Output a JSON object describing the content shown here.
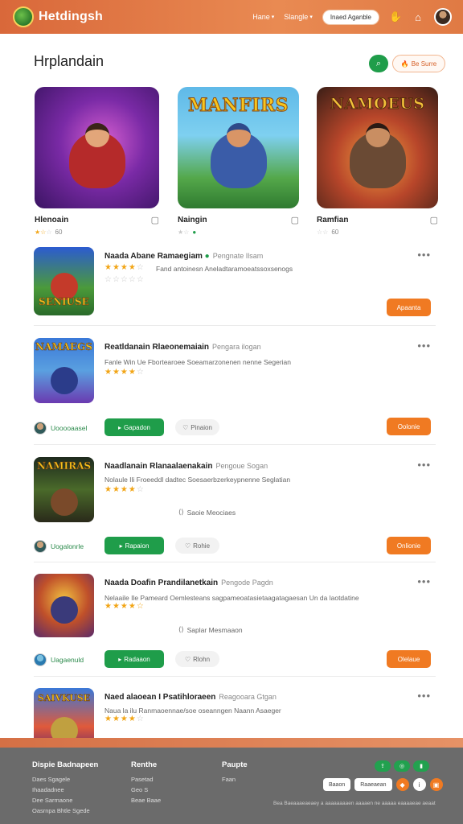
{
  "header": {
    "brand": "Hetdingsh",
    "nav": [
      {
        "label": "Hane"
      },
      {
        "label": "Slangle"
      }
    ],
    "action_pill": "Inaed Aganble",
    "colors": {
      "header_orange": "#e07a44",
      "accent_green": "#1f9d4a",
      "accent_orange": "#f07a22"
    }
  },
  "main": {
    "title": "Hrplandain",
    "sort_label": "Be Surre"
  },
  "featured": [
    {
      "name": "Hlenoain",
      "rating_text": "60",
      "banner": ""
    },
    {
      "name": "Naingin",
      "rating_text": "",
      "banner": "MANFIRS"
    },
    {
      "name": "Ramfian",
      "rating_text": "60",
      "banner": "NAMOEUS"
    }
  ],
  "rows": [
    {
      "title": "Naada Abane Ramaegiam",
      "sub": "Pengnate Ilsam",
      "desc": "Fand antoinesn Aneladtaramoeatssoxsenogs",
      "thumb_banner": "SENIUSE",
      "action": "Apaanta"
    },
    {
      "title": "Reatldanain Rlaeonemaiain",
      "sub": "Pengara ilogan",
      "desc": "Fanle Win Ue  Fbortearoee Soeamarzonenen nenne Segerian",
      "thumb_banner": "NAMAEGS",
      "user": "Uooooaasel",
      "green_btn": "Gapadon",
      "like": "Pinaion",
      "action": "Oolonie"
    },
    {
      "title": "Naadlanain Rlanaalaenakain",
      "sub": "Pengoue Sogan",
      "desc": "Nolaule Ili  Froeeddl dadtec Soesaerbzerkeypnenne Seglatian",
      "mid_note": "Saoie Meociaes",
      "thumb_banner": "NAMIRAS",
      "user": "Uogalonrle",
      "green_btn": "Rapaion",
      "like": "Rohie",
      "action": "Onlionie"
    },
    {
      "title": "Naada Doafin Prandilanetkain",
      "sub": "Pengode Pagdn",
      "desc": "Nelaaile Ile  Pameard Oemlesteans sagpameoatasietaagatagaesan  Un da laotdatine",
      "mid_note": "Saplar Mesmaaon",
      "thumb_banner": "",
      "user": "Uagaenuld",
      "green_btn": "Radaaon",
      "like": "Rlohn",
      "action": "Olelaue"
    },
    {
      "title": "Naed alaoean I Psatihloraeen",
      "sub": "Reagooara Gtgan",
      "desc": "Naua la ilu  Ranmaoennae/soe oseanngen Naann Asaeger",
      "thumb_banner": "SAIVKUSE"
    }
  ],
  "footer": {
    "col1_title": "Dispie Badnapeen",
    "col1_links": [
      "Daes Sgagele",
      "Ihaadadnee",
      "Dee Sarmaone",
      "Oasrnpa Bhtle Sgede"
    ],
    "col2_title": "Renthe",
    "col2_links": [
      "Pasetad",
      "Geo S",
      "Beae Baae"
    ],
    "col3_title": "Paupte",
    "col3_links": [
      "Faan"
    ],
    "buttons": [
      "Baaon",
      "Raaeaean"
    ],
    "copyright": "Bea Baeaaaeaeaey a aaaaaaaaen aaaaen ne aaaaa eaaaaeae aeaat"
  }
}
